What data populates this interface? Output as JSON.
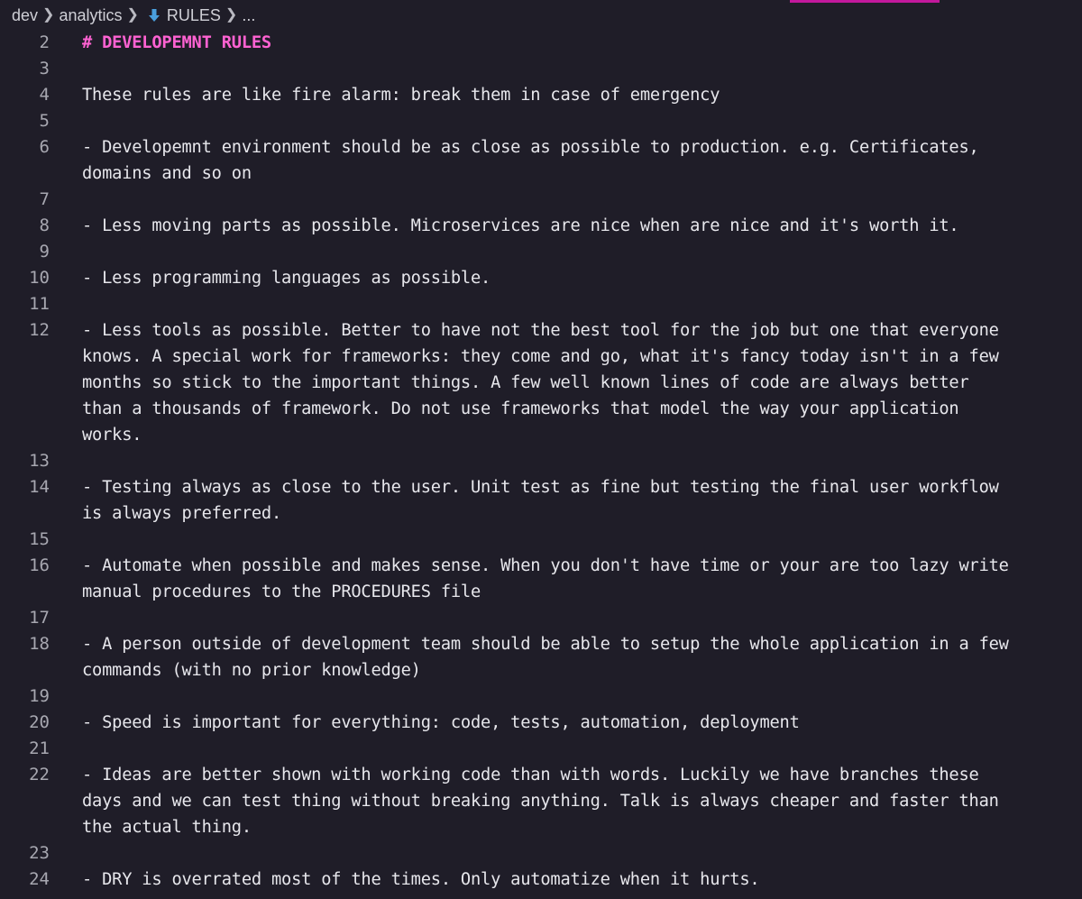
{
  "theme": {
    "background": "#1f1d28",
    "heading_color": "#ff62d2",
    "text_color": "#e7e7ec",
    "line_number_color": "#a7a7b0",
    "tab_indicator_color": "#c2189c",
    "file_icon_color": "#4a9fdd"
  },
  "breadcrumb": {
    "items": [
      {
        "label": "dev"
      },
      {
        "label": "analytics"
      },
      {
        "label": "RULES",
        "icon": "markdown-download-icon"
      },
      {
        "label": "..."
      }
    ]
  },
  "editor": {
    "lines": [
      {
        "number": "2",
        "text": "# DEVELOPEMNT RULES",
        "kind": "heading"
      },
      {
        "number": "3",
        "text": ""
      },
      {
        "number": "4",
        "text": "These rules are like fire alarm: break them in case of emergency"
      },
      {
        "number": "5",
        "text": ""
      },
      {
        "number": "6",
        "text": "- Developemnt environment should be as close as possible to production. e.g. Certificates,\ndomains and so on"
      },
      {
        "number": "7",
        "text": ""
      },
      {
        "number": "8",
        "text": "- Less moving parts as possible. Microservices are nice when are nice and it's worth it."
      },
      {
        "number": "9",
        "text": ""
      },
      {
        "number": "10",
        "text": "- Less programming languages as possible."
      },
      {
        "number": "11",
        "text": ""
      },
      {
        "number": "12",
        "text": "- Less tools as possible. Better to have not the best tool for the job but one that everyone\nknows. A special work for frameworks: they come and go, what it's fancy today isn't in a few\nmonths so stick to the important things. A few well known lines of code are always better\nthan a thousands of framework. Do not use frameworks that model the way your application\nworks."
      },
      {
        "number": "13",
        "text": ""
      },
      {
        "number": "14",
        "text": "- Testing always as close to the user. Unit test as fine but testing the final user workflow\nis always preferred."
      },
      {
        "number": "15",
        "text": ""
      },
      {
        "number": "16",
        "text": "- Automate when possible and makes sense. When you don't have time or your are too lazy write\nmanual procedures to the PROCEDURES file"
      },
      {
        "number": "17",
        "text": ""
      },
      {
        "number": "18",
        "text": "- A person outside of development team should be able to setup the whole application in a few\ncommands (with no prior knowledge)"
      },
      {
        "number": "19",
        "text": ""
      },
      {
        "number": "20",
        "text": "- Speed is important for everything: code, tests, automation, deployment"
      },
      {
        "number": "21",
        "text": ""
      },
      {
        "number": "22",
        "text": "- Ideas are better shown with working code than with words. Luckily we have branches these\ndays and we can test thing without breaking anything. Talk is always cheaper and faster than\nthe actual thing."
      },
      {
        "number": "23",
        "text": ""
      },
      {
        "number": "24",
        "text": "- DRY is overrated most of the times. Only automatize when it hurts."
      }
    ]
  }
}
